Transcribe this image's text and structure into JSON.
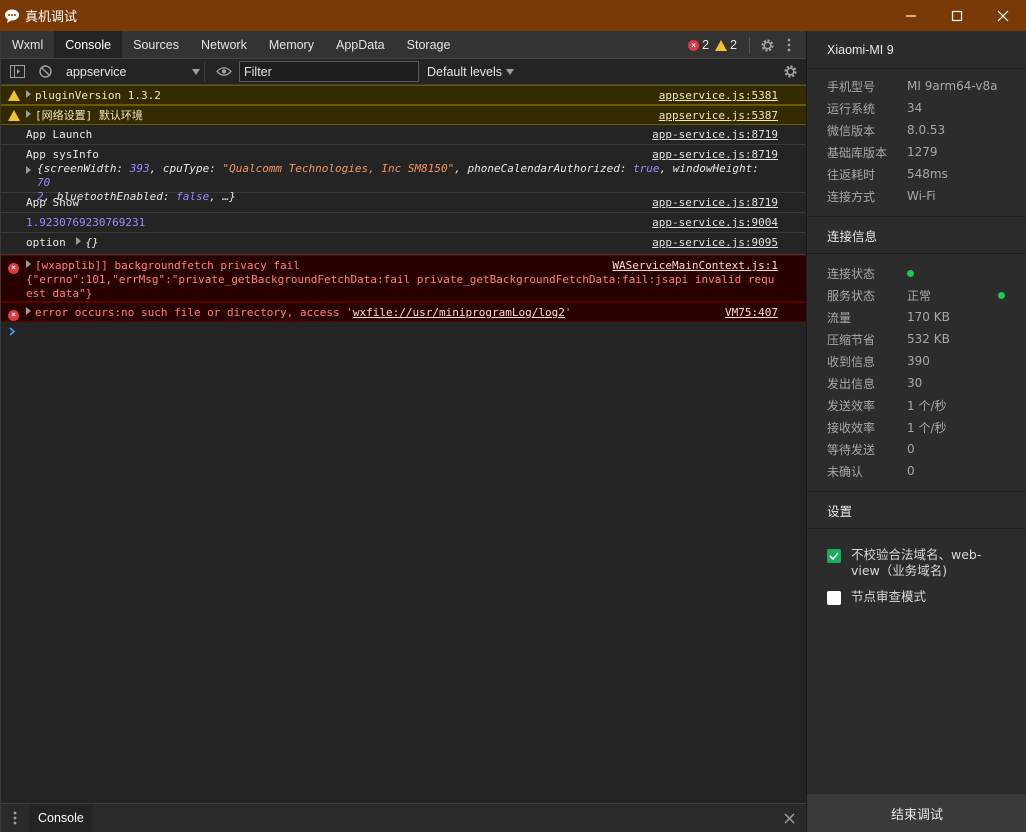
{
  "window": {
    "title": "真机调试",
    "icon": "speech-bubble-icon"
  },
  "tabs": [
    {
      "label": "Wxml",
      "active": false
    },
    {
      "label": "Console",
      "active": true
    },
    {
      "label": "Sources",
      "active": false
    },
    {
      "label": "Network",
      "active": false
    },
    {
      "label": "Memory",
      "active": false
    },
    {
      "label": "AppData",
      "active": false
    },
    {
      "label": "Storage",
      "active": false
    }
  ],
  "counts": {
    "errors": "2",
    "warnings": "2"
  },
  "toolbar": {
    "context": "appservice",
    "filter_placeholder": "Filter",
    "levels": "Default levels"
  },
  "logs": [
    {
      "level": "warn",
      "text": "pluginVersion 1.3.2",
      "source": "appservice.js:5381"
    },
    {
      "level": "warn",
      "text": "[网络设置] 默认环境",
      "source": "appservice.js:5387"
    },
    {
      "level": "info",
      "text": "App Launch",
      "source": "app-service.js:8719"
    },
    {
      "level": "info",
      "text": "App sysInfo",
      "source": "app-service.js:8719",
      "obj_line1_parts": [
        "{screenWidth: ",
        "393",
        ", cpuType: ",
        "\"Qualcomm Technologies, Inc SM8150\"",
        ", phoneCalendarAuthorized: ",
        "true",
        ", windowHeight: ",
        "70"
      ],
      "obj_line2_parts": [
        "2",
        ", bluetoothEnabled: ",
        "false",
        ", …}"
      ]
    },
    {
      "level": "info",
      "text": "App Show",
      "source": "app-service.js:8719"
    },
    {
      "level": "info",
      "text": "1.9230769230769231",
      "source": "app-service.js:9004"
    },
    {
      "level": "info",
      "text": "option",
      "suffix": "{}",
      "source": "app-service.js:9095"
    },
    {
      "level": "error",
      "text": "[wxapplib]] backgroundfetch privacy fail",
      "source": "WAServiceMainContext.js:1",
      "detail": "{\"errno\":101,\"errMsg\":\"private_getBackgroundFetchData:fail private_getBackgroundFetchData:fail:jsapi invalid request data\"}"
    },
    {
      "level": "error",
      "text_prefix": "error occurs:no such file or directory, access '",
      "link": "wxfile://usr/miniprogramLog/log2",
      "text_suffix": "'",
      "source": "VM75:407"
    }
  ],
  "drawer": {
    "tab": "Console"
  },
  "device": {
    "name": "Xiaomi-MI 9",
    "info": [
      {
        "k": "手机型号",
        "v": "MI 9arm64-v8a"
      },
      {
        "k": "运行系统",
        "v": "34"
      },
      {
        "k": "微信版本",
        "v": "8.0.53"
      },
      {
        "k": "基础库版本",
        "v": "1279"
      },
      {
        "k": "往返耗时",
        "v": "548ms"
      },
      {
        "k": "连接方式",
        "v": "Wi-Fi"
      }
    ],
    "conn_title": "连接信息",
    "conn": [
      {
        "k": "连接状态",
        "v": "",
        "dot": true
      },
      {
        "k": "服务状态",
        "v": "正常",
        "dot_right": true
      },
      {
        "k": "流量",
        "v": "170 KB"
      },
      {
        "k": "压缩节省",
        "v": "532 KB"
      },
      {
        "k": "收到信息",
        "v": "390"
      },
      {
        "k": "发出信息",
        "v": "30"
      },
      {
        "k": "发送效率",
        "v": "1 个/秒"
      },
      {
        "k": "接收效率",
        "v": "1 个/秒"
      },
      {
        "k": "等待发送",
        "v": "0"
      },
      {
        "k": "未确认",
        "v": "0"
      }
    ],
    "settings_title": "设置",
    "settings": [
      {
        "label": "不校验合法域名、web-view（业务域名)",
        "checked": true
      },
      {
        "label": "节点审查模式",
        "checked": false
      }
    ],
    "end_button": "结束调试"
  },
  "colors": {
    "titlebar": "#7a3a07",
    "accent_green": "#1aad5e",
    "error": "#e0383e",
    "warning": "#f2c12e"
  }
}
